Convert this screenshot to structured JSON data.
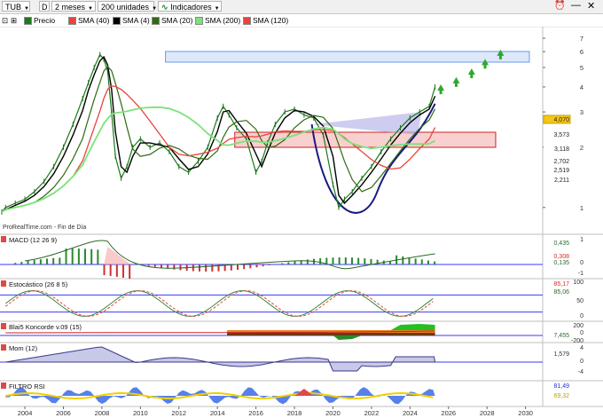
{
  "toolbar": {
    "symbol": "TUB",
    "d_button": "D",
    "period": "2 meses",
    "units": "200 unidades",
    "indicators": "Indicadores"
  },
  "legend": [
    {
      "label": "Precio",
      "color": "#1a7a1a"
    },
    {
      "label": "SMA (40)",
      "color": "#e8443a"
    },
    {
      "label": "SMA (4)",
      "color": "#000000"
    },
    {
      "label": "SMA (20)",
      "color": "#2e6b12"
    },
    {
      "label": "SMA (200)",
      "color": "#7ae37a"
    },
    {
      "label": "SMA (120)",
      "color": "#e8443a"
    }
  ],
  "watermark": "ProRealTime.com - Fin de Día",
  "panels": {
    "macd": "MACD (12 26 9)",
    "stoch": "Estocástico (26 8 5)",
    "koncorde": "Blai5 Koncorde v.09 (15)",
    "mom": "Mom (12)",
    "rsi": "FILTRO RSI"
  },
  "chart_data": {
    "type": "line",
    "title": "",
    "x": [
      2002.8,
      2003.0,
      2003.5,
      2004.0,
      2004.5,
      2005.0,
      2005.5,
      2006.0,
      2006.5,
      2007.0,
      2007.3,
      2007.6,
      2007.9,
      2008.1,
      2008.3,
      2008.5,
      2008.7,
      2009.0,
      2009.3,
      2009.6,
      2010.0,
      2010.5,
      2011.0,
      2011.5,
      2012.0,
      2012.5,
      2013.0,
      2013.5,
      2014.0,
      2014.3,
      2014.6,
      2015.0,
      2015.5,
      2016.0,
      2016.3,
      2016.6,
      2017.0,
      2017.5,
      2018.0,
      2018.5,
      2019.0,
      2019.5,
      2020.0,
      2020.3,
      2020.6,
      2021.0,
      2021.5,
      2022.0,
      2022.5,
      2023.0,
      2023.5,
      2024.0,
      2024.5,
      2025.0,
      2025.3
    ],
    "series": [
      {
        "name": "Precio",
        "values": [
          0.95,
          1.0,
          1.05,
          1.1,
          1.2,
          1.35,
          1.6,
          2.0,
          2.6,
          3.5,
          4.2,
          5.0,
          5.8,
          5.5,
          4.8,
          3.0,
          1.8,
          1.4,
          1.6,
          2.0,
          2.2,
          2.0,
          2.1,
          1.9,
          1.6,
          1.5,
          1.7,
          2.0,
          2.8,
          3.2,
          2.9,
          2.5,
          2.2,
          1.5,
          1.7,
          2.1,
          2.6,
          3.0,
          3.1,
          2.9,
          2.8,
          2.3,
          1.3,
          1.0,
          1.1,
          1.2,
          1.4,
          1.6,
          1.9,
          2.2,
          2.5,
          2.8,
          3.0,
          3.2,
          4.0
        ]
      }
    ],
    "x_ticks": [
      "2004",
      "2006",
      "2008",
      "2010",
      "2012",
      "2014",
      "2016",
      "2018",
      "2020",
      "2022",
      "2024",
      "2026",
      "2028",
      "2030"
    ],
    "y_ticks": [
      "7",
      "6",
      "5",
      "4",
      "3",
      "2",
      "1"
    ],
    "price_labels": [
      "4,070",
      "3,573",
      "3,118",
      "2,702",
      "2,519",
      "2,211"
    ],
    "macd_labels": [
      "0,435",
      "0,308",
      "0,135",
      "0"
    ],
    "macd_ticks": [
      "1",
      "0",
      "-1"
    ],
    "stoch_labels": [
      "85,17",
      "85,06"
    ],
    "stoch_ticks": [
      "100",
      "50",
      "0"
    ],
    "koncorde_labels": [
      "7,455"
    ],
    "koncorde_ticks": [
      "200",
      "0",
      "-200"
    ],
    "mom_labels": [
      "1,579"
    ],
    "mom_ticks": [
      "4",
      "0",
      "-4"
    ],
    "rsi_labels": [
      "81,49",
      "69,32"
    ],
    "grid": false
  }
}
